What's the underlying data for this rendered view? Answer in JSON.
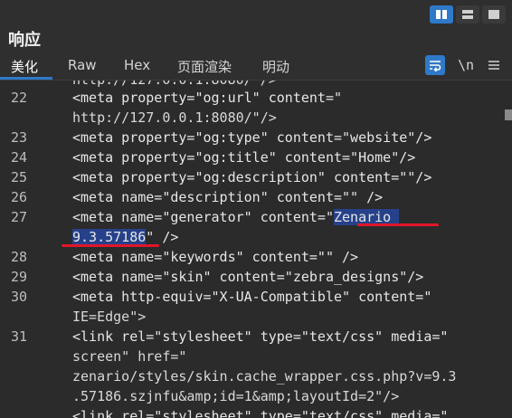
{
  "panel_title": "响应",
  "tabs": [
    "美化",
    "Raw",
    "Hex",
    "页面渲染",
    "明动"
  ],
  "active_tab": "美化",
  "tools": {
    "newline_label": "\\n"
  },
  "colors": {
    "accent": "#2f79c9",
    "highlight": "#26418a",
    "annotation": "#e0162b"
  },
  "icons": {
    "layout": [
      "split-vertical-icon",
      "split-horizontal-icon",
      "single-pane-icon"
    ],
    "wrap": "word-wrap-icon",
    "menu": "hamburger-menu-icon"
  },
  "code": {
    "partial_top": "http://127.0.0.1:8080/\"/>",
    "lines": [
      {
        "n": "22",
        "rows": [
          "<meta property=\"og:url\" content=\"",
          "http://127.0.0.1:8080/\"/>"
        ]
      },
      {
        "n": "23",
        "rows": [
          "<meta property=\"og:type\" content=\"website\"/>"
        ]
      },
      {
        "n": "24",
        "rows": [
          "<meta property=\"og:title\" content=\"Home\"/>"
        ]
      },
      {
        "n": "25",
        "rows": [
          "<meta property=\"og:description\" content=\"\"/>"
        ]
      },
      {
        "n": "26",
        "rows": [
          "<meta name=\"description\" content=\"\" />"
        ]
      },
      {
        "n": "27",
        "rows": [
          "<meta name=\"generator\" content=\"",
          "\" />"
        ]
      },
      {
        "n": "28",
        "rows": [
          "<meta name=\"keywords\" content=\"\" />"
        ]
      },
      {
        "n": "29",
        "rows": [
          "<meta name=\"skin\" content=\"zebra_designs\"/>"
        ]
      },
      {
        "n": "30",
        "rows": [
          "<meta http-equiv=\"X-UA-Compatible\" content=\"",
          "IE=Edge\">"
        ]
      },
      {
        "n": "31",
        "rows": [
          "<link rel=\"stylesheet\" type=\"text/css\" media=\"",
          "screen\" href=\"",
          "zenario/styles/skin.cache_wrapper.css.php?v=9.3",
          ".57186.szjnfu&amp;id=1&amp;layoutId=2\"/>"
        ]
      }
    ],
    "partial_bottom": "<link rel=\"stylesheet\" type=\"text/css\" media=\"",
    "highlight_part1": "Zenario ",
    "highlight_part2": "9.3.57186"
  }
}
